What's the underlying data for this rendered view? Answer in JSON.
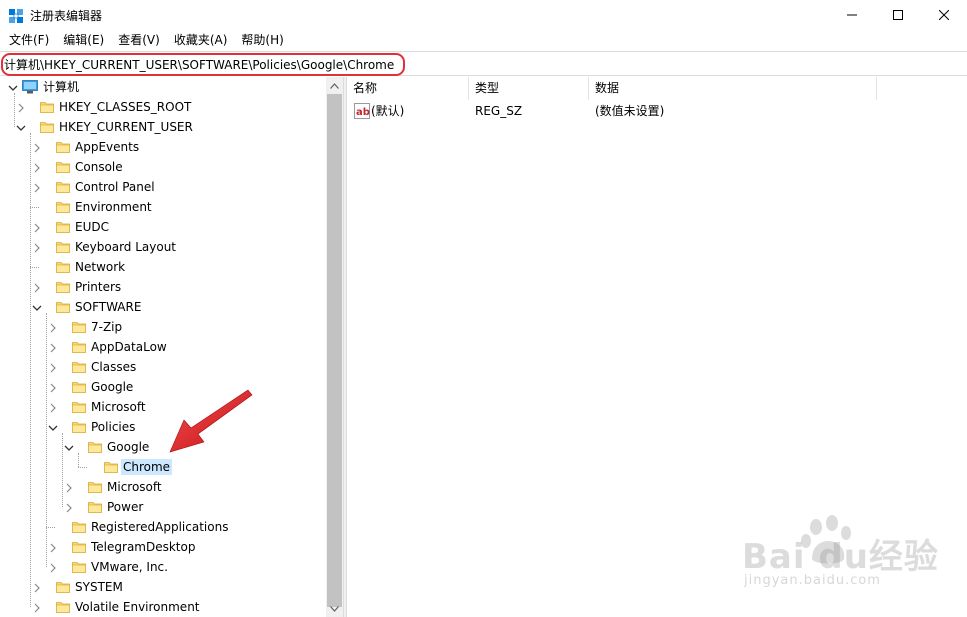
{
  "window": {
    "title": "注册表编辑器",
    "accent_color": "#0078d7"
  },
  "menu": [
    "文件(F)",
    "编辑(E)",
    "查看(V)",
    "收藏夹(A)",
    "帮助(H)"
  ],
  "address": {
    "path": "计算机\\HKEY_CURRENT_USER\\SOFTWARE\\Policies\\Google\\Chrome",
    "highlight_color": "#e0303a"
  },
  "tree": [
    {
      "label": "计算机",
      "depth": 0,
      "expander": "expanded",
      "icon": "computer-icon"
    },
    {
      "label": "HKEY_CLASSES_ROOT",
      "depth": 1,
      "expander": "collapsed",
      "icon": "folder-icon"
    },
    {
      "label": "HKEY_CURRENT_USER",
      "depth": 1,
      "expander": "expanded",
      "icon": "folder-icon"
    },
    {
      "label": "AppEvents",
      "depth": 2,
      "expander": "collapsed",
      "icon": "folder-icon"
    },
    {
      "label": "Console",
      "depth": 2,
      "expander": "collapsed",
      "icon": "folder-icon"
    },
    {
      "label": "Control Panel",
      "depth": 2,
      "expander": "collapsed",
      "icon": "folder-icon"
    },
    {
      "label": "Environment",
      "depth": 2,
      "expander": "none",
      "icon": "folder-icon"
    },
    {
      "label": "EUDC",
      "depth": 2,
      "expander": "collapsed",
      "icon": "folder-icon"
    },
    {
      "label": "Keyboard Layout",
      "depth": 2,
      "expander": "collapsed",
      "icon": "folder-icon"
    },
    {
      "label": "Network",
      "depth": 2,
      "expander": "none",
      "icon": "folder-icon"
    },
    {
      "label": "Printers",
      "depth": 2,
      "expander": "collapsed",
      "icon": "folder-icon"
    },
    {
      "label": "SOFTWARE",
      "depth": 2,
      "expander": "expanded",
      "icon": "folder-icon"
    },
    {
      "label": "7-Zip",
      "depth": 3,
      "expander": "collapsed",
      "icon": "folder-icon"
    },
    {
      "label": "AppDataLow",
      "depth": 3,
      "expander": "collapsed",
      "icon": "folder-icon"
    },
    {
      "label": "Classes",
      "depth": 3,
      "expander": "collapsed",
      "icon": "folder-icon"
    },
    {
      "label": "Google",
      "depth": 3,
      "expander": "collapsed",
      "icon": "folder-icon"
    },
    {
      "label": "Microsoft",
      "depth": 3,
      "expander": "collapsed",
      "icon": "folder-icon"
    },
    {
      "label": "Policies",
      "depth": 3,
      "expander": "expanded",
      "icon": "folder-icon"
    },
    {
      "label": "Google",
      "depth": 4,
      "expander": "expanded",
      "icon": "folder-icon"
    },
    {
      "label": "Chrome",
      "depth": 5,
      "expander": "none",
      "icon": "folder-icon",
      "selected": true
    },
    {
      "label": "Microsoft",
      "depth": 4,
      "expander": "collapsed",
      "icon": "folder-icon"
    },
    {
      "label": "Power",
      "depth": 4,
      "expander": "collapsed",
      "icon": "folder-icon"
    },
    {
      "label": "RegisteredApplications",
      "depth": 3,
      "expander": "none",
      "icon": "folder-icon"
    },
    {
      "label": "TelegramDesktop",
      "depth": 3,
      "expander": "collapsed",
      "icon": "folder-icon"
    },
    {
      "label": "VMware, Inc.",
      "depth": 3,
      "expander": "collapsed",
      "icon": "folder-icon"
    },
    {
      "label": "SYSTEM",
      "depth": 2,
      "expander": "collapsed",
      "icon": "folder-icon"
    },
    {
      "label": "Volatile Environment",
      "depth": 2,
      "expander": "collapsed",
      "icon": "folder-icon"
    }
  ],
  "list": {
    "columns": [
      "名称",
      "类型",
      "数据"
    ],
    "rows": [
      {
        "name": "(默认)",
        "type": "REG_SZ",
        "data": "(数值未设置)",
        "icon": "string-value-icon"
      }
    ]
  },
  "watermark": {
    "brand": "Bai  du经验",
    "url": "jingyan.baidu.com"
  }
}
